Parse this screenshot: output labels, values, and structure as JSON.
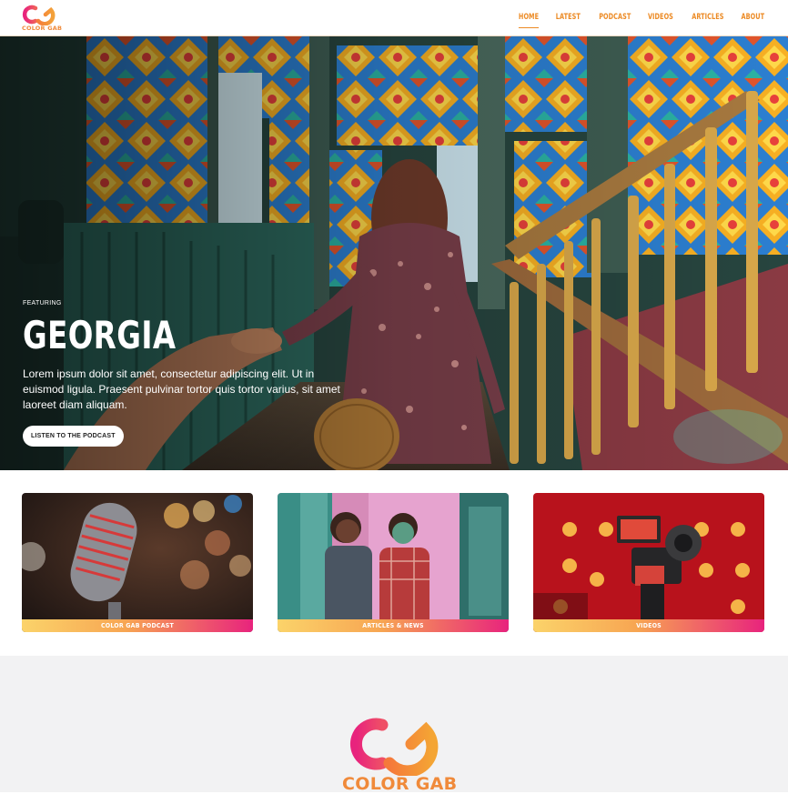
{
  "header": {
    "logo_text": "COLOR GAB",
    "nav": [
      {
        "label": "HOME",
        "active": true
      },
      {
        "label": "LATEST",
        "active": false
      },
      {
        "label": "PODCAST",
        "active": false
      },
      {
        "label": "VIDEOS",
        "active": false
      },
      {
        "label": "ARTICLES",
        "active": false
      },
      {
        "label": "ABOUT",
        "active": false
      }
    ]
  },
  "hero": {
    "eyebrow": "FEATURING",
    "title": "GEORGIA",
    "description": "Lorem ipsum dolor sit amet, consectetur adipiscing elit. Ut in euismod ligula. Praesent pulvinar tortor quis tortor varius, sit amet laoreet diam aliquam.",
    "cta_label": "LISTEN TO THE PODCAST"
  },
  "cards": [
    {
      "label": "COLOR GAB PODCAST",
      "image": "microphone-photo"
    },
    {
      "label": "ARTICLES & NEWS",
      "image": "kids-photo"
    },
    {
      "label": "VIDEOS",
      "image": "camera-photo"
    }
  ],
  "footer": {
    "logo_text": "COLOR GAB"
  },
  "colors": {
    "brand_orange": "#f08a3a",
    "brand_pink": "#e8237d",
    "nav_orange": "#ec8a24",
    "gradient_start": "#fbd36a",
    "gradient_end": "#e8237d"
  }
}
